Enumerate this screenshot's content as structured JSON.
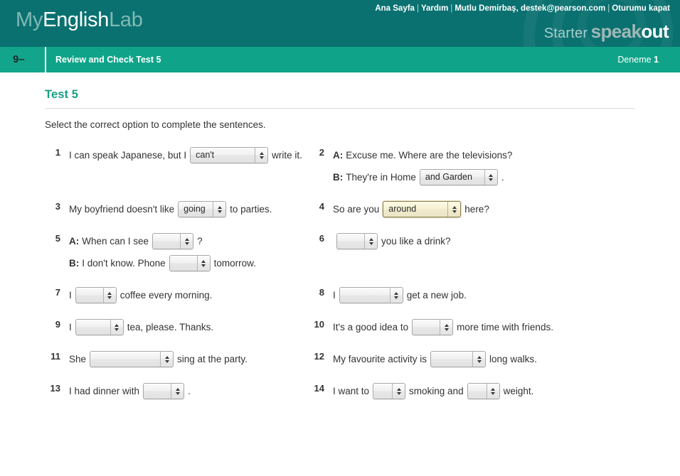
{
  "header": {
    "logo": {
      "part1": "My",
      "part2": "English",
      "part3": "Lab"
    },
    "toplinks": [
      {
        "label": "Ana Sayfa"
      },
      {
        "label": "Yardım"
      },
      {
        "label": "Mutlu Demirbaş, destek@pearson.com"
      },
      {
        "label": "Oturumu kapat"
      }
    ],
    "separator": "|",
    "brand": {
      "level": "Starter",
      "name1": "speak",
      "name2": "out"
    }
  },
  "navbar": {
    "step": "9–",
    "title": "Review and Check Test 5",
    "attempt_label": "Deneme",
    "attempt_number": "1"
  },
  "content": {
    "page_title": "Test 5",
    "instructions": "Select the correct option to complete the sentences."
  },
  "questions": [
    {
      "number": "1",
      "lines": [
        {
          "speaker": "",
          "parts": [
            {
              "type": "text",
              "value": "I can speak Japanese, but I"
            },
            {
              "type": "select",
              "value": "can't",
              "width": "w-3xl",
              "state": "normal"
            },
            {
              "type": "text",
              "value": "write it."
            }
          ]
        }
      ]
    },
    {
      "number": "2",
      "lines": [
        {
          "speaker": "A:",
          "parts": [
            {
              "type": "text",
              "value": "Excuse me. Where are the televisions?"
            }
          ]
        },
        {
          "speaker": "B:",
          "parts": [
            {
              "type": "text",
              "value": "They're in Home"
            },
            {
              "type": "select",
              "value": "and Garden",
              "width": "w-3xl",
              "state": "normal"
            },
            {
              "type": "text",
              "value": "."
            }
          ]
        }
      ]
    },
    {
      "number": "3",
      "lines": [
        {
          "speaker": "",
          "parts": [
            {
              "type": "text",
              "value": "My boyfriend doesn't like"
            },
            {
              "type": "select",
              "value": "going",
              "width": "w-l",
              "state": "normal"
            },
            {
              "type": "text",
              "value": "to parties."
            }
          ]
        }
      ]
    },
    {
      "number": "4",
      "lines": [
        {
          "speaker": "",
          "parts": [
            {
              "type": "text",
              "value": "So are you"
            },
            {
              "type": "select",
              "value": "around",
              "width": "w-3xl",
              "state": "focused"
            },
            {
              "type": "text",
              "value": "here?"
            }
          ]
        }
      ]
    },
    {
      "number": "5",
      "lines": [
        {
          "speaker": "A:",
          "parts": [
            {
              "type": "text",
              "value": "When can I see"
            },
            {
              "type": "select",
              "value": "",
              "width": "w-m",
              "state": "normal"
            },
            {
              "type": "text",
              "value": "?"
            }
          ]
        },
        {
          "speaker": "B:",
          "parts": [
            {
              "type": "text",
              "value": "I don't know. Phone"
            },
            {
              "type": "select",
              "value": "",
              "width": "w-m",
              "state": "normal"
            },
            {
              "type": "text",
              "value": "tomorrow."
            }
          ]
        }
      ]
    },
    {
      "number": "6",
      "lines": [
        {
          "speaker": "",
          "parts": [
            {
              "type": "select",
              "value": "",
              "width": "w-m",
              "state": "normal"
            },
            {
              "type": "text",
              "value": "you like a drink?"
            }
          ]
        }
      ]
    },
    {
      "number": "7",
      "lines": [
        {
          "speaker": "",
          "parts": [
            {
              "type": "text",
              "value": "I"
            },
            {
              "type": "select",
              "value": "",
              "width": "w-m",
              "state": "normal"
            },
            {
              "type": "text",
              "value": "coffee every morning."
            }
          ]
        }
      ]
    },
    {
      "number": "8",
      "lines": [
        {
          "speaker": "",
          "parts": [
            {
              "type": "text",
              "value": "I"
            },
            {
              "type": "select",
              "value": "",
              "width": "w-2xl",
              "state": "normal"
            },
            {
              "type": "text",
              "value": "get a new job."
            }
          ]
        }
      ]
    },
    {
      "number": "9",
      "lines": [
        {
          "speaker": "",
          "parts": [
            {
              "type": "text",
              "value": "I"
            },
            {
              "type": "select",
              "value": "",
              "width": "w-l",
              "state": "normal"
            },
            {
              "type": "text",
              "value": "tea, please. Thanks."
            }
          ]
        }
      ]
    },
    {
      "number": "10",
      "lines": [
        {
          "speaker": "",
          "parts": [
            {
              "type": "text",
              "value": "It's a good idea to"
            },
            {
              "type": "select",
              "value": "",
              "width": "w-m",
              "state": "normal"
            },
            {
              "type": "text",
              "value": "more time with friends."
            }
          ]
        }
      ]
    },
    {
      "number": "11",
      "lines": [
        {
          "speaker": "",
          "parts": [
            {
              "type": "text",
              "value": "She"
            },
            {
              "type": "select",
              "value": "",
              "width": "w-4xl",
              "state": "normal"
            },
            {
              "type": "text",
              "value": "sing at the party."
            }
          ]
        }
      ]
    },
    {
      "number": "12",
      "lines": [
        {
          "speaker": "",
          "parts": [
            {
              "type": "text",
              "value": "My favourite activity is"
            },
            {
              "type": "select",
              "value": "",
              "width": "w-xl",
              "state": "normal"
            },
            {
              "type": "text",
              "value": "long walks."
            }
          ]
        }
      ]
    },
    {
      "number": "13",
      "lines": [
        {
          "speaker": "",
          "parts": [
            {
              "type": "text",
              "value": "I had dinner with"
            },
            {
              "type": "select",
              "value": "",
              "width": "w-m",
              "state": "normal"
            },
            {
              "type": "text",
              "value": "."
            }
          ]
        }
      ]
    },
    {
      "number": "14",
      "lines": [
        {
          "speaker": "",
          "parts": [
            {
              "type": "text",
              "value": "I want to"
            },
            {
              "type": "select",
              "value": "",
              "width": "w-s",
              "state": "normal"
            },
            {
              "type": "text",
              "value": "smoking and"
            },
            {
              "type": "select",
              "value": "",
              "width": "w-s",
              "state": "normal"
            },
            {
              "type": "text",
              "value": "weight."
            }
          ]
        }
      ]
    }
  ],
  "colors": {
    "header_teal": "#0a7170",
    "nav_green": "#13a58c",
    "title_green": "#17a085",
    "focus_cream": "#f6f1cf"
  }
}
